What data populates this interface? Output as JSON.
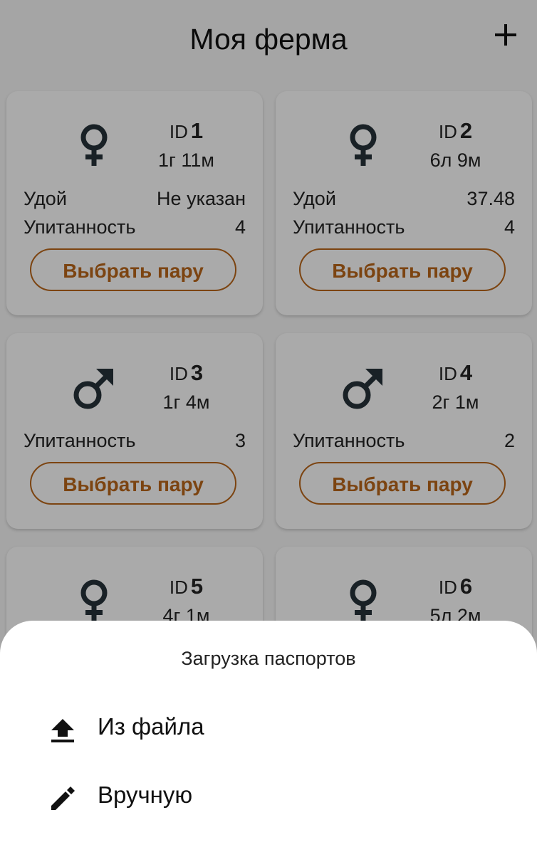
{
  "header": {
    "title": "Моя ферма",
    "add_icon": "plus-icon"
  },
  "cards": [
    {
      "id_label": "ID",
      "id_value": "1",
      "sex": "female",
      "sex_icon": "female-icon",
      "age": "1г 11м",
      "rows": [
        {
          "label": "Удой",
          "value": "Не указан"
        },
        {
          "label": "Упитанность",
          "value": "4"
        }
      ],
      "button": "Выбрать пару"
    },
    {
      "id_label": "ID",
      "id_value": "2",
      "sex": "female",
      "sex_icon": "female-icon",
      "age": "6л 9м",
      "rows": [
        {
          "label": "Удой",
          "value": "37.48"
        },
        {
          "label": "Упитанность",
          "value": "4"
        }
      ],
      "button": "Выбрать пару"
    },
    {
      "id_label": "ID",
      "id_value": "3",
      "sex": "male",
      "sex_icon": "male-icon",
      "age": "1г 4м",
      "rows": [
        {
          "label": "Упитанность",
          "value": "3"
        }
      ],
      "button": "Выбрать пару"
    },
    {
      "id_label": "ID",
      "id_value": "4",
      "sex": "male",
      "sex_icon": "male-icon",
      "age": "2г 1м",
      "rows": [
        {
          "label": "Упитанность",
          "value": "2"
        }
      ],
      "button": "Выбрать пару"
    },
    {
      "id_label": "ID",
      "id_value": "5",
      "sex": "female",
      "sex_icon": "female-icon",
      "age": "4г 1м"
    },
    {
      "id_label": "ID",
      "id_value": "6",
      "sex": "female",
      "sex_icon": "female-icon",
      "age": "5л 2м"
    }
  ],
  "sheet": {
    "title": "Загрузка паспортов",
    "options": [
      {
        "label": "Из файла",
        "icon": "upload-icon"
      },
      {
        "label": "Вручную",
        "icon": "pencil-icon"
      }
    ]
  },
  "colors": {
    "accent": "#b7651a",
    "icon": "#263238",
    "background": "#f3f3f3",
    "scrim": "rgba(0,0,0,0.32)"
  }
}
